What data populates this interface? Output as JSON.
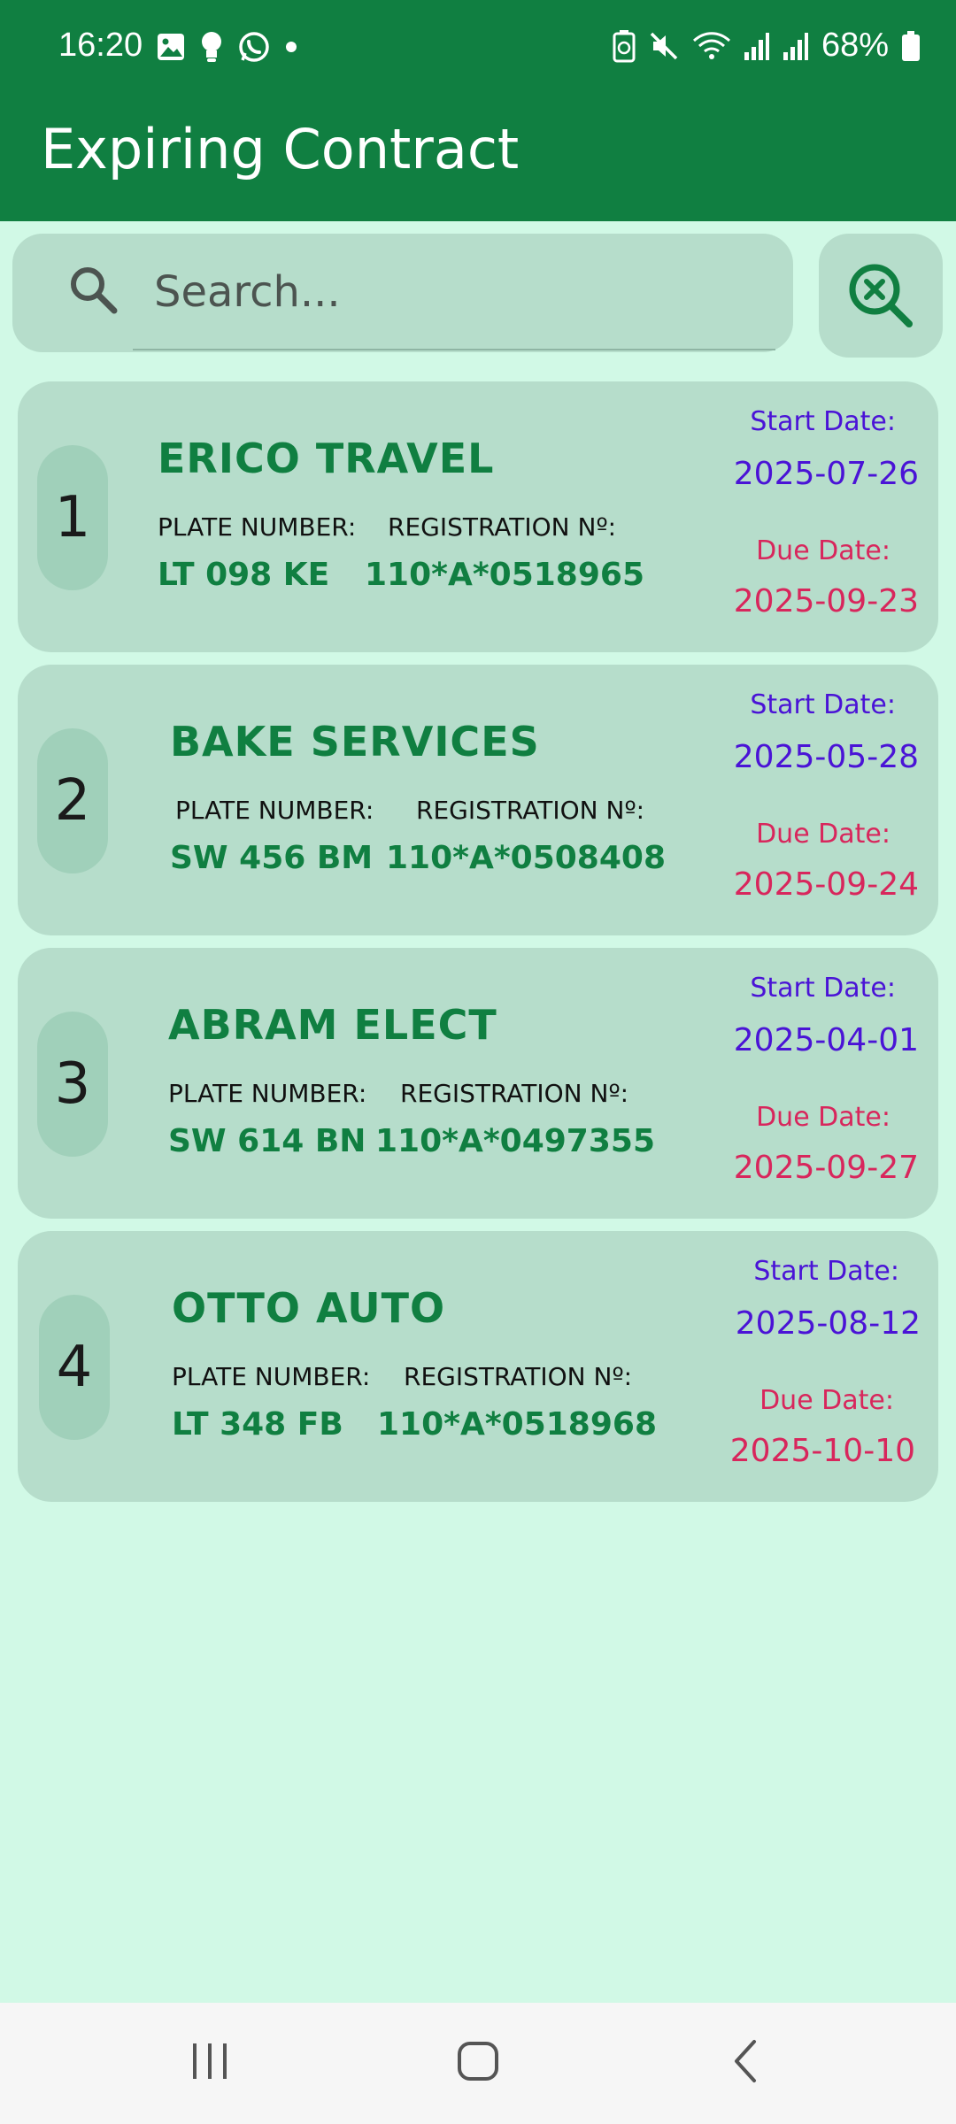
{
  "status_bar": {
    "time": "16:20",
    "battery_percent": "68%",
    "left_icons": [
      "image-icon",
      "bulb-icon",
      "whatsapp-icon",
      "dot-icon"
    ],
    "right_icons": [
      "battery-saver-icon",
      "mute-icon",
      "wifi-icon",
      "signal-icon",
      "signal-icon",
      "battery-icon"
    ]
  },
  "app_bar": {
    "title": "Expiring Contract"
  },
  "search": {
    "placeholder": "Search...",
    "value": ""
  },
  "colors": {
    "primary": "#107f41",
    "background": "#d1f9e6",
    "card": "#b6ddcb",
    "start_date": "#4a13d6",
    "due_date": "#d8265c"
  },
  "contracts": [
    {
      "index": "1",
      "company": "ERICO TRAVEL",
      "plate_label": "PLATE NUMBER:",
      "plate": "LT 098 KE",
      "reg_label": "REGISTRATION Nº:",
      "registration": "110*A*0518965",
      "start_label": "Start Date:",
      "start_date": "2025-07-26",
      "due_label": "Due Date:",
      "due_date": "2025-09-23"
    },
    {
      "index": "2",
      "company": "BAKE SERVICES",
      "plate_label": "PLATE NUMBER:",
      "plate": "SW 456 BM",
      "reg_label": "REGISTRATION Nº:",
      "registration": "110*A*0508408",
      "start_label": "Start Date:",
      "start_date": "2025-05-28",
      "due_label": "Due Date:",
      "due_date": "2025-09-24"
    },
    {
      "index": "3",
      "company": "ABRAM ELECT",
      "plate_label": "PLATE NUMBER:",
      "plate": "SW 614 BN",
      "reg_label": "REGISTRATION Nº:",
      "registration": "110*A*0497355",
      "start_label": "Start Date:",
      "start_date": "2025-04-01",
      "due_label": "Due Date:",
      "due_date": "2025-09-27"
    },
    {
      "index": "4",
      "company": "OTTO AUTO",
      "plate_label": "PLATE NUMBER:",
      "plate": "LT 348 FB",
      "reg_label": "REGISTRATION Nº:",
      "registration": "110*A*0518968",
      "start_label": "Start Date:",
      "start_date": "2025-08-12",
      "due_label": "Due Date:",
      "due_date": "2025-10-10"
    }
  ],
  "nav_bar": {
    "buttons": [
      "recent-apps-icon",
      "home-icon",
      "back-icon"
    ]
  }
}
